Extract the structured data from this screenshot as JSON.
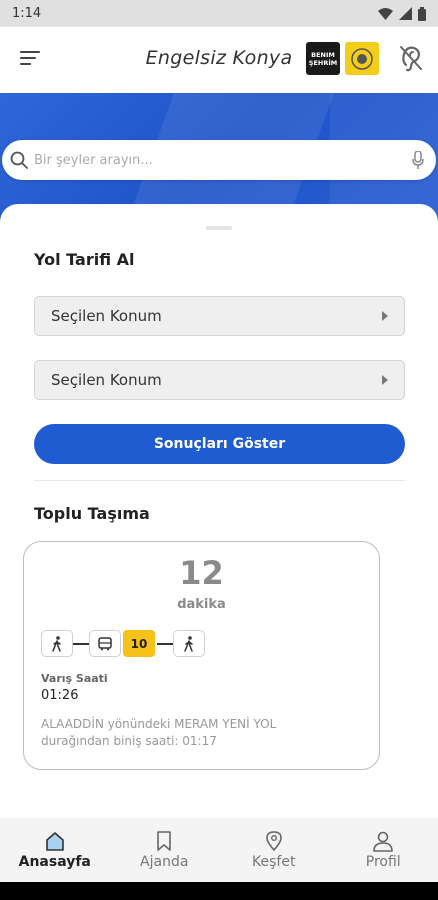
{
  "status_bar": {
    "time": "1:14"
  },
  "header": {
    "title": "Engelsiz Konya",
    "logo_benim_lines": [
      "BENIM",
      "ŞEHRİM"
    ]
  },
  "search": {
    "placeholder": "Bir şeyler arayın..."
  },
  "directions": {
    "title": "Yol Tarifi Al",
    "from_field": "Seçilen Konum",
    "to_field": "Seçilen Konum",
    "show_button": "Sonuçları Göster"
  },
  "transit": {
    "title": "Toplu Taşıma",
    "minutes": "12",
    "minutes_unit": "dakika",
    "bus_number": "10",
    "arrival_label": "Varış Saati",
    "arrival_time": "01:26",
    "boarding_info": "ALAADDİN yönündeki MERAM YENİ YOL durağından biniş saati: 01:17"
  },
  "bottom_nav": {
    "items": [
      {
        "label": "Anasayfa",
        "icon": "home-icon",
        "active": true
      },
      {
        "label": "Ajanda",
        "icon": "bookmark-icon",
        "active": false
      },
      {
        "label": "Keşfet",
        "icon": "location-pin-icon",
        "active": false
      },
      {
        "label": "Profil",
        "icon": "person-icon",
        "active": false
      }
    ]
  },
  "colors": {
    "accent": "#1f5bd1",
    "bus_badge": "#f6c21a",
    "hero": "#2a5fd4"
  }
}
